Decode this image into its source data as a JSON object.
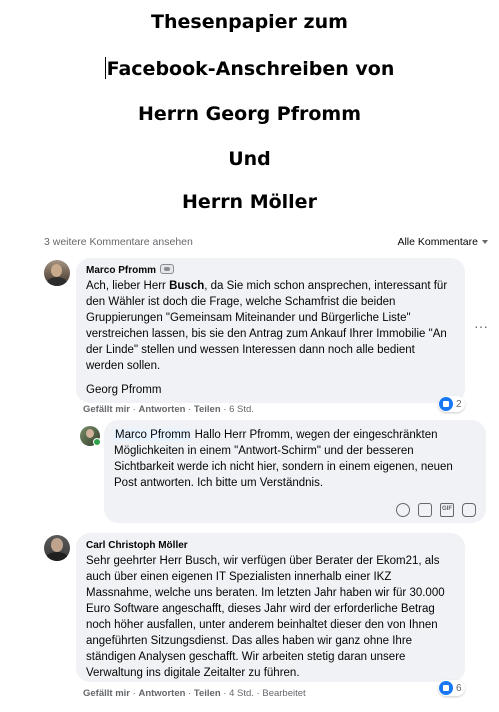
{
  "document": {
    "title_lines": [
      "Thesenpapier zum",
      "Facebook-Anschreiben von",
      "Herrn Georg Pfromm",
      "Und",
      "Herrn Möller"
    ]
  },
  "comments_header": {
    "more_comments": "3 weitere Kommentare ansehen",
    "sort_label": "Alle Kommentare"
  },
  "comments": [
    {
      "author": "Marco Pfromm",
      "text_before_bold": "Ach, lieber Herr ",
      "bold": "Busch",
      "text_after_bold": ", da Sie mich schon ansprechen, interessant für den Wähler ist doch die Frage, welche Schamfrist die beiden Gruppierungen \"Gemeinsam Miteinander und Bürgerliche Liste\" verstreichen lassen, bis sie den Antrag zum Ankauf Ihrer Immobilie \"An der Linde\" stellen und wessen Interessen dann noch alle bedient werden sollen.",
      "signature": "Georg Pfromm",
      "actions": {
        "like": "Gefällt mir",
        "reply": "Antworten",
        "share": "Teilen",
        "time": "6 Std."
      },
      "reaction_count": "2",
      "more": "···"
    },
    {
      "mention": "Marco Pfromm",
      "text": " Hallo Herr Pfromm, wegen der eingeschränkten Möglichkeiten in einem \"Antwort-Schirm\" und der besseren Sichtbarkeit werde ich nicht hier, sondern in einem eigenen, neuen Post antworten. Ich bitte um Verständnis.",
      "tools": [
        "emoji-icon",
        "camera-icon",
        "gif-icon",
        "sticker-icon"
      ],
      "gif_label": "GIF"
    },
    {
      "author": "Carl Christoph Möller",
      "text": "Sehr geehrter Herr Busch, wir verfügen über Berater der Ekom21, als auch über einen eigenen IT Spezialisten innerhalb einer IKZ Massnahme, welche uns beraten. Im letzten Jahr haben wir für 30.000 Euro Software angeschafft, dieses Jahr wird der erforderliche Betrag noch höher ausfallen, unter anderem beinhaltet dieser den von Ihnen angeführten Sitzungsdienst. Das alles haben wir ganz ohne Ihre ständigen Analysen geschafft. Wir arbeiten stetig daran unsere Verwaltung ins digitale Zeitalter zu führen.",
      "actions": {
        "like": "Gefällt mir",
        "reply": "Antworten",
        "share": "Teilen",
        "time": "4 Std.",
        "edited": "Bearbeitet"
      },
      "reaction_count": "6"
    }
  ],
  "colors": {
    "bubble": "#f0f2f5",
    "like_blue": "#1877f2",
    "meta_gray": "#65676b",
    "mention_bg": "#e7f3ff"
  }
}
